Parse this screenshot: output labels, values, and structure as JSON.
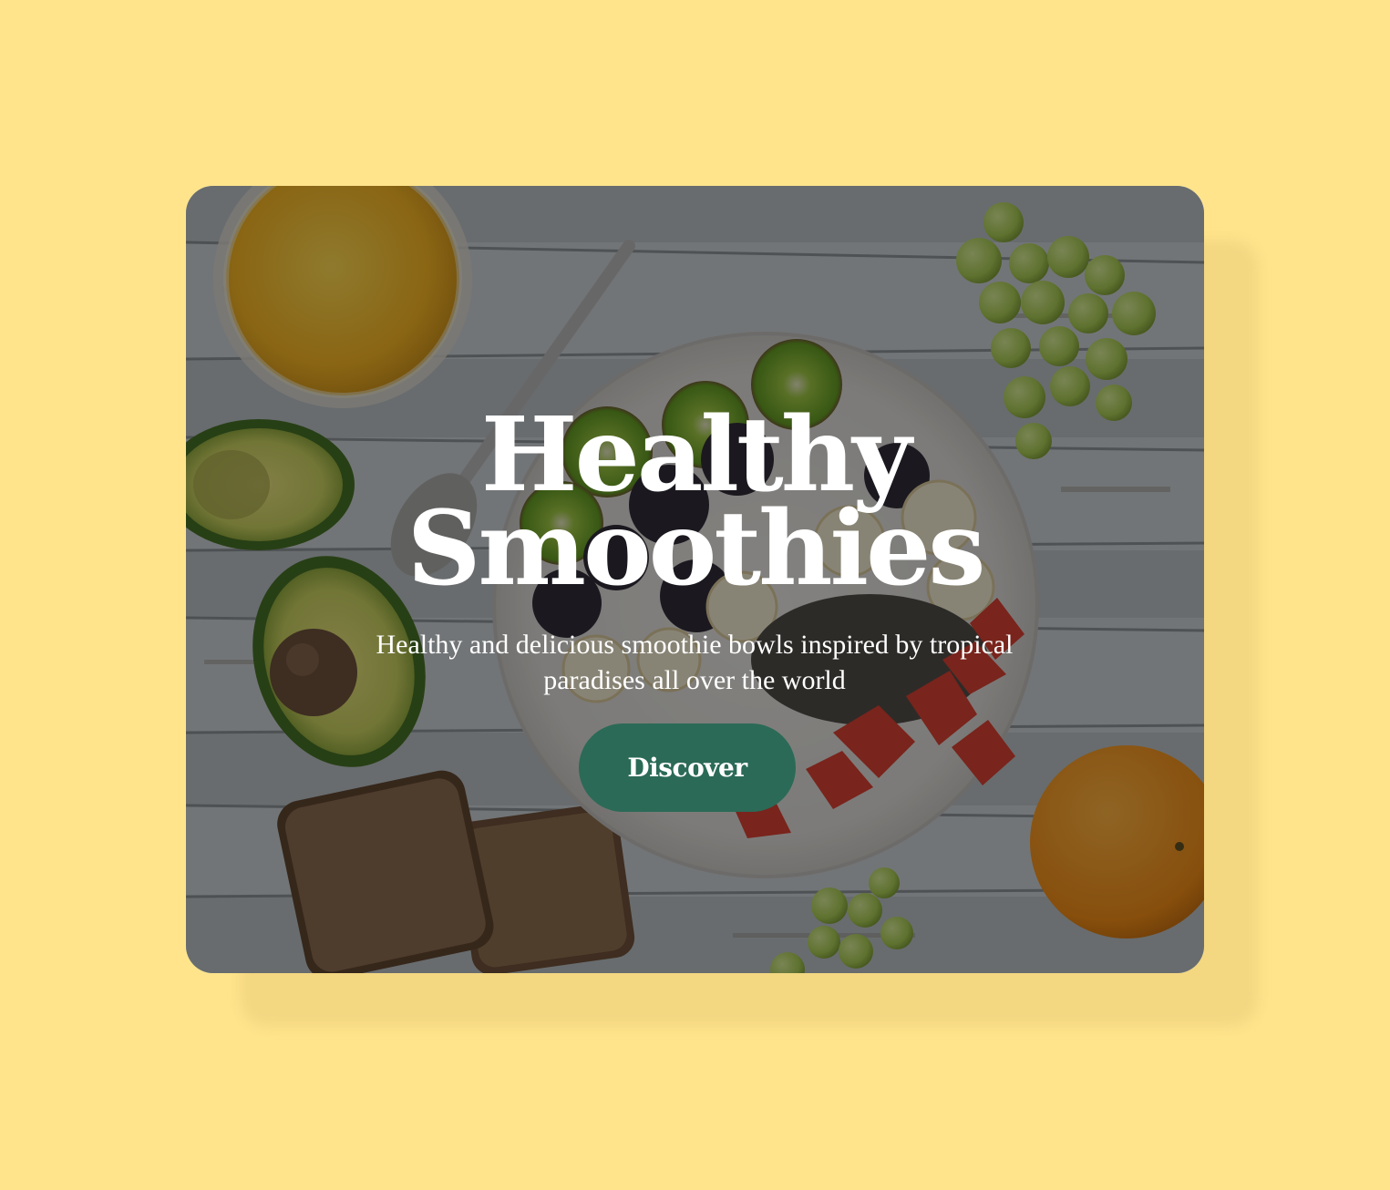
{
  "page": {
    "background_color": "#ffe48c"
  },
  "hero": {
    "title_line1": "Healthy",
    "title_line2": "Smoothies",
    "subtitle": "Healthy and delicious smoothie bowls inspired by tropical paradises all over the world",
    "cta_label": "Discover",
    "cta_color": "#2b6a57",
    "overlay_opacity": 0.46
  },
  "image": {
    "subject": "smoothie-bowl-breakfast-photo"
  }
}
